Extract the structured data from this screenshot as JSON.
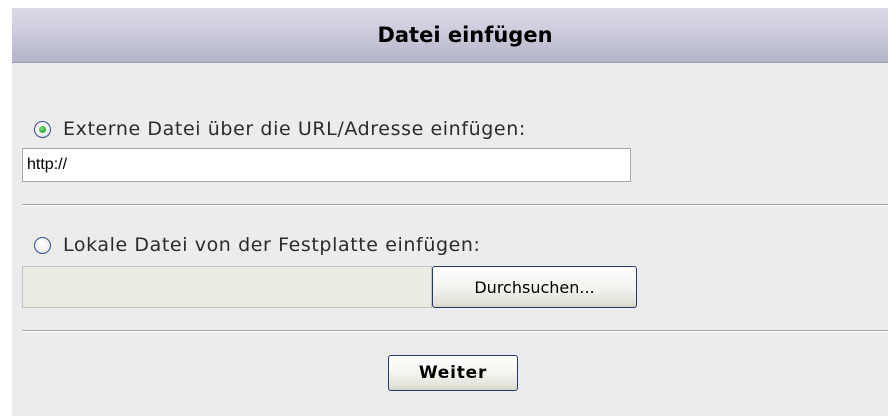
{
  "dialog": {
    "title": "Datei einfügen"
  },
  "external_option": {
    "label": "Externe Datei über die URL/Adresse einfügen:",
    "selected": true,
    "url_value": "http://"
  },
  "local_option": {
    "label": "Lokale Datei von der Festplatte einfügen:",
    "selected": false,
    "file_value": "",
    "browse_label": "Durchsuchen..."
  },
  "actions": {
    "next_label": "Weiter"
  }
}
